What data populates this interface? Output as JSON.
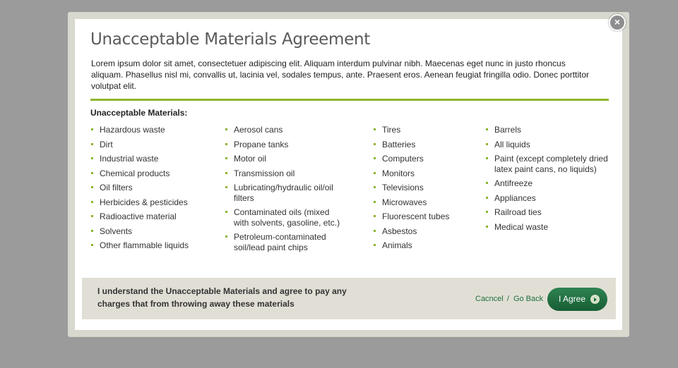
{
  "dialog": {
    "title": "Unacceptable Materials Agreement",
    "intro": "Lorem ipsum dolor sit amet, consectetuer adipiscing elit. Aliquam interdum pulvinar nibh. Maecenas eget nunc in justo rhoncus aliquam. Phasellus nisl mi, convallis ut, lacinia vel, sodales tempus, ante. Praesent eros. Aenean feugiat fringilla odio. Donec porttitor volutpat elit.",
    "materials_heading": "Unacceptable Materials:",
    "columns": [
      [
        "Hazardous waste",
        "Dirt",
        "Industrial waste",
        "Chemical products",
        "Oil filters",
        "Herbicides & pesticides",
        "Radioactive material",
        "Solvents",
        "Other flammable liquids"
      ],
      [
        "Aerosol cans",
        "Propane tanks",
        "Motor oil",
        "Transmission oil",
        "Lubricating/hydraulic oil/oil filters",
        "Contaminated oils (mixed with solvents, gasoline, etc.)",
        "Petroleum-contaminated soil/lead paint chips"
      ],
      [
        "Tires",
        "Batteries",
        "Computers",
        "Monitors",
        "Televisions",
        "Microwaves",
        "Fluorescent tubes",
        "Asbestos",
        "Animals"
      ],
      [
        "Barrels",
        "All liquids",
        "Paint (except completely dried latex paint cans, no liquids)",
        "Antifreeze",
        "Appliances",
        "Railroad ties",
        "Medical waste"
      ]
    ],
    "close_glyph": "×"
  },
  "footer": {
    "agree_statement": "I understand the Unacceptable Materials and agree to pay any charges that from throwing away these materials",
    "cancel_label": "Cacncel",
    "separator": "/",
    "go_back_label": "Go Back",
    "agree_label": "I Agree"
  },
  "colors": {
    "overlay": "#9b9b9b",
    "accent_green": "#8db52c",
    "button_green": "#1e6d3f",
    "footer_bg": "#e1dfd5"
  },
  "icons": [
    "close-icon",
    "arrow-right-icon"
  ]
}
